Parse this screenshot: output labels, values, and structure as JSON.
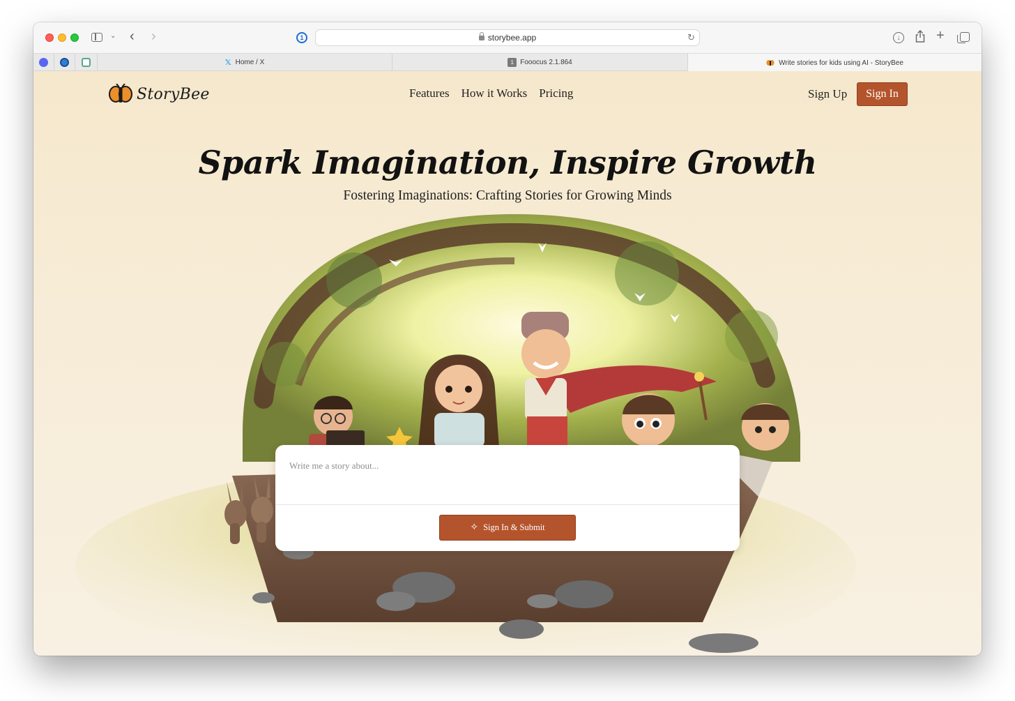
{
  "browser": {
    "url": "storybee.app",
    "tabs": [
      {
        "label": "Home / X",
        "icon": "x-logo-icon"
      },
      {
        "label": "Fooocus 2.1.864",
        "icon": "number-one-icon",
        "badge": "1"
      },
      {
        "label": "Write stories for kids using AI - StoryBee",
        "icon": "bee-icon",
        "active": true
      }
    ],
    "pinned_tabs": [
      "discord-icon",
      "boat-icon",
      "openai-icon"
    ]
  },
  "header": {
    "logo_text": "StoryBee",
    "nav": [
      {
        "label": "Features"
      },
      {
        "label": "How it Works"
      },
      {
        "label": "Pricing"
      }
    ],
    "signup_label": "Sign Up",
    "signin_label": "Sign In"
  },
  "hero": {
    "title": "Spark Imagination, Inspire Growth",
    "subtitle": "Fostering Imaginations: Crafting Stories for Growing Minds"
  },
  "story_form": {
    "placeholder": "Write me a story about...",
    "value": "",
    "submit_label": "Sign In & Submit"
  },
  "colors": {
    "accent": "#b4542c",
    "page_background": "#f6e8cc"
  }
}
